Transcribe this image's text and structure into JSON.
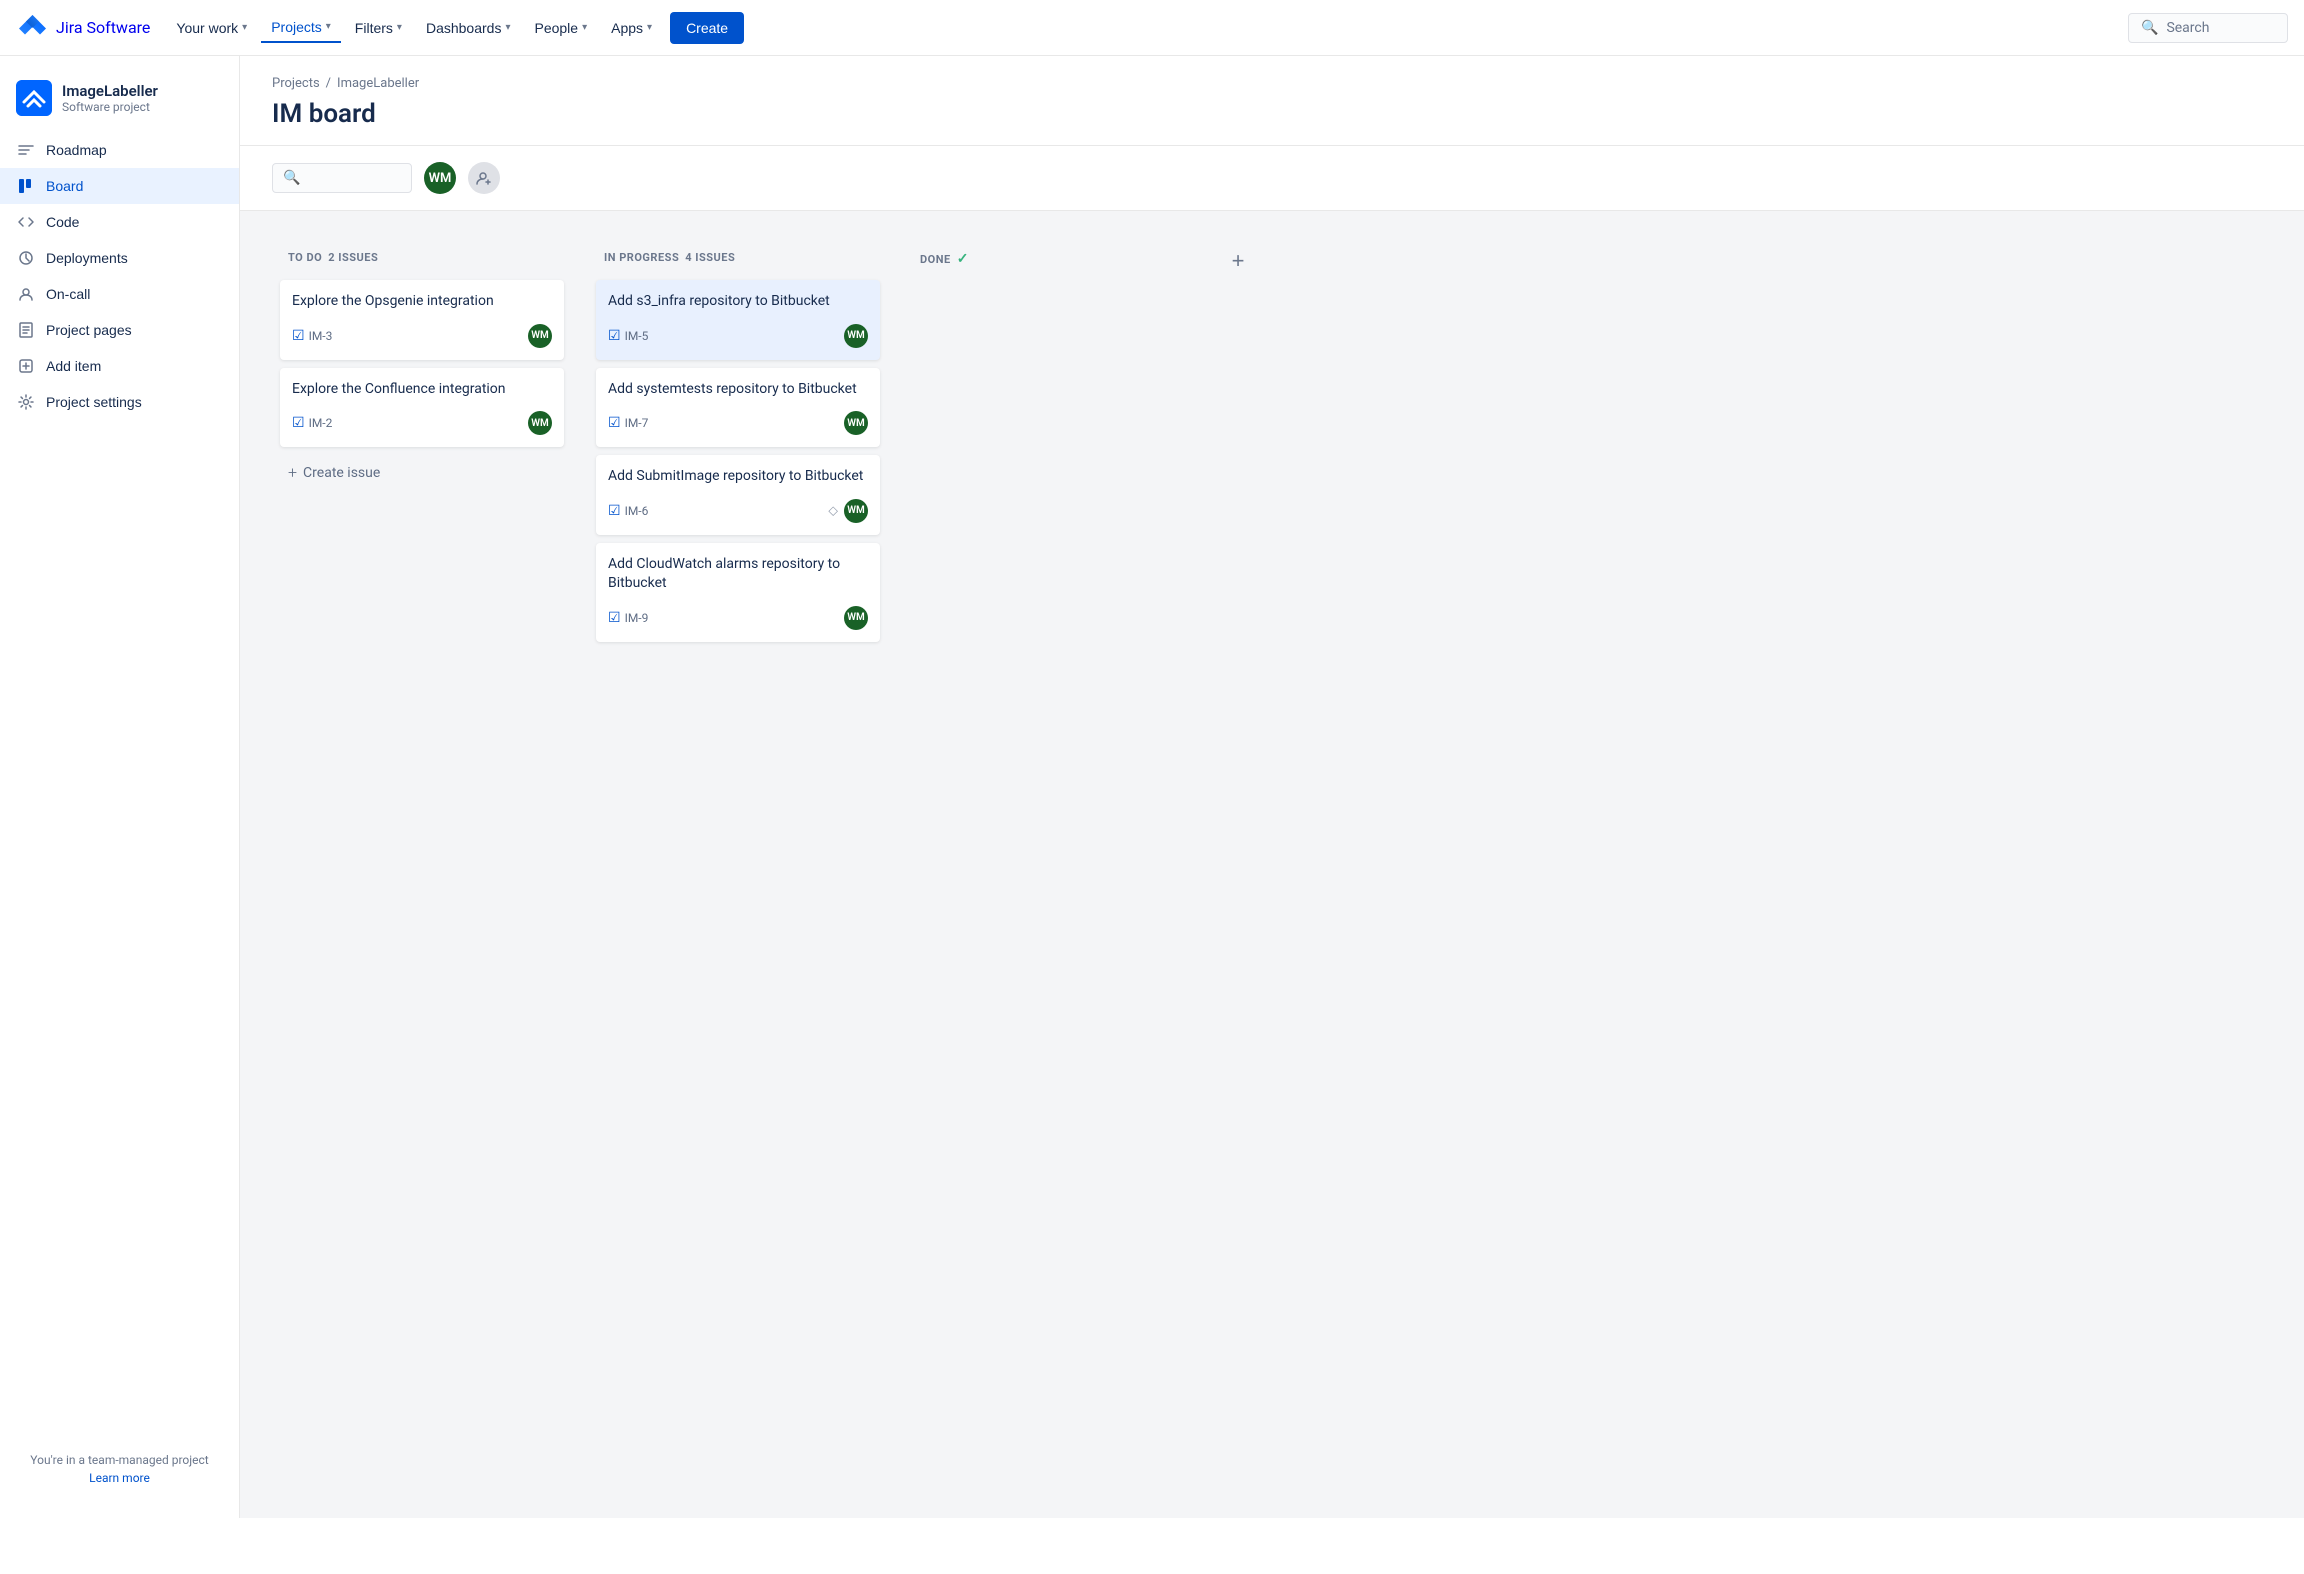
{
  "topnav": {
    "logo_text": "Jira Software",
    "items": [
      {
        "id": "your-work",
        "label": "Your work",
        "has_chevron": true,
        "active": false
      },
      {
        "id": "projects",
        "label": "Projects",
        "has_chevron": true,
        "active": true
      },
      {
        "id": "filters",
        "label": "Filters",
        "has_chevron": true,
        "active": false
      },
      {
        "id": "dashboards",
        "label": "Dashboards",
        "has_chevron": true,
        "active": false
      },
      {
        "id": "people",
        "label": "People",
        "has_chevron": true,
        "active": false
      },
      {
        "id": "apps",
        "label": "Apps",
        "has_chevron": true,
        "active": false
      }
    ],
    "create_label": "Create",
    "search_placeholder": "Search"
  },
  "sidebar": {
    "project_name": "ImageLabeller",
    "project_type": "Software project",
    "nav_items": [
      {
        "id": "roadmap",
        "label": "Roadmap",
        "icon": "roadmap"
      },
      {
        "id": "board",
        "label": "Board",
        "icon": "board",
        "active": true
      },
      {
        "id": "code",
        "label": "Code",
        "icon": "code"
      },
      {
        "id": "deployments",
        "label": "Deployments",
        "icon": "deployments"
      },
      {
        "id": "on-call",
        "label": "On-call",
        "icon": "on-call"
      },
      {
        "id": "project-pages",
        "label": "Project pages",
        "icon": "project-pages"
      },
      {
        "id": "add-item",
        "label": "Add item",
        "icon": "add-item"
      },
      {
        "id": "project-settings",
        "label": "Project settings",
        "icon": "project-settings"
      }
    ],
    "team_text": "You're in a team-managed project",
    "learn_more": "Learn more"
  },
  "breadcrumb": {
    "projects_label": "Projects",
    "separator": "/",
    "current": "ImageLabeller"
  },
  "board": {
    "title": "IM board",
    "columns": [
      {
        "id": "todo",
        "title": "TO DO",
        "issue_count": "2 ISSUES",
        "done_check": false,
        "cards": [
          {
            "id": "im3",
            "title": "Explore the Opsgenie integration",
            "issue_key": "IM-3",
            "assignee": "WM",
            "highlighted": false
          },
          {
            "id": "im2",
            "title": "Explore the Confluence integration",
            "issue_key": "IM-2",
            "assignee": "WM",
            "highlighted": false
          }
        ],
        "create_label": "Create issue"
      },
      {
        "id": "inprogress",
        "title": "IN PROGRESS",
        "issue_count": "4 ISSUES",
        "done_check": false,
        "cards": [
          {
            "id": "im5",
            "title": "Add s3_infra repository to Bitbucket",
            "issue_key": "IM-5",
            "assignee": "WM",
            "highlighted": true
          },
          {
            "id": "im7",
            "title": "Add systemtests repository to Bitbucket",
            "issue_key": "IM-7",
            "assignee": "WM",
            "highlighted": false
          },
          {
            "id": "im6",
            "title": "Add SubmitImage repository to Bitbucket",
            "issue_key": "IM-6",
            "assignee": "WM",
            "highlighted": false,
            "has_pin": true
          },
          {
            "id": "im9",
            "title": "Add CloudWatch alarms repository to Bitbucket",
            "issue_key": "IM-9",
            "assignee": "WM",
            "highlighted": false
          }
        ],
        "create_label": null
      },
      {
        "id": "done",
        "title": "DONE",
        "issue_count": null,
        "done_check": true,
        "cards": [],
        "create_label": null
      }
    ],
    "add_column_label": "+"
  }
}
